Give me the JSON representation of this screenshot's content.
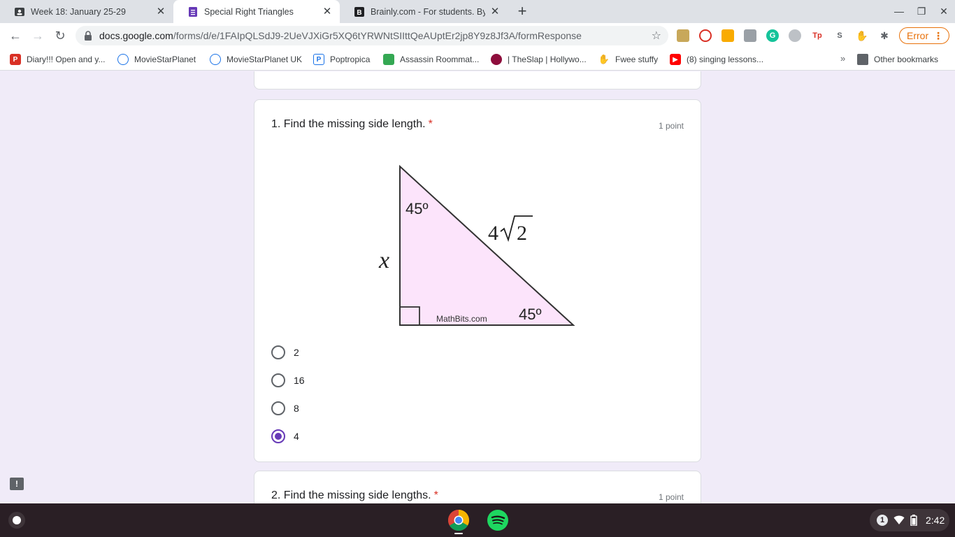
{
  "browser": {
    "tabs": [
      {
        "title": "Week 18: January 25-29",
        "active": false
      },
      {
        "title": "Special Right Triangles",
        "active": true
      },
      {
        "title": "Brainly.com - For students. By st",
        "active": false
      }
    ],
    "url_host": "docs.google.com",
    "url_path": "/forms/d/e/1FAIpQLSdJ9-2UeVJXiGr5XQ6tYRWNtSIIttQeAUptEr2jp8Y9z8Jf3A/formResponse",
    "profile_status": "Error",
    "bookmarks": [
      "Diary!!! Open and y...",
      "MovieStarPlanet",
      "MovieStarPlanet UK",
      "Poptropica",
      "Assassin Roommat...",
      "| TheSlap | Hollywo...",
      "Fwee stuffy",
      "(8) singing lessons...",
      "Other bookmarks"
    ],
    "bookmarks_more": "»"
  },
  "form": {
    "question1": {
      "title": "1. Find the missing side length.",
      "required_mark": "*",
      "points": "1 point",
      "figure": {
        "angle_top": "45º",
        "angle_bottom": "45º",
        "hyp_coef": "4",
        "hyp_radicand": "2",
        "leg_label": "x",
        "watermark": "MathBits.com",
        "fill_color": "#fce4fb"
      },
      "options": [
        {
          "label": "2",
          "checked": false
        },
        {
          "label": "16",
          "checked": false
        },
        {
          "label": "8",
          "checked": false
        },
        {
          "label": "4",
          "checked": true
        }
      ]
    },
    "question2": {
      "title": "2. Find the missing side lengths.",
      "required_mark": "*",
      "points": "1 point"
    }
  },
  "shelf": {
    "notification_count": "1",
    "time": "2:42"
  },
  "colors": {
    "accent": "#673ab7",
    "page_bg": "#f0ebf8",
    "required": "#d93025"
  }
}
